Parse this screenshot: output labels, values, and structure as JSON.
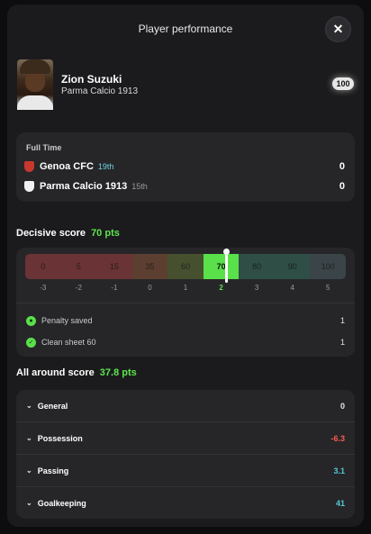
{
  "header": {
    "title": "Player performance",
    "close_label": "✕"
  },
  "player": {
    "name": "Zion Suzuki",
    "team": "Parma Calcio 1913",
    "score": "100"
  },
  "full_time": {
    "label": "Full Time",
    "teams": [
      {
        "name": "Genoa CFC",
        "rank": "19th",
        "score": "0",
        "rank_color": "#6fd3e0",
        "crest_color": "#c9382e"
      },
      {
        "name": "Parma Calcio 1913",
        "rank": "15th",
        "score": "0",
        "rank_color": "#9a9a9e",
        "crest_color": "#f0f0f0"
      }
    ]
  },
  "decisive": {
    "label": "Decisive score",
    "points": "70 pts",
    "scale_values": [
      "0",
      "5",
      "15",
      "35",
      "60",
      "70",
      "80",
      "90",
      "100"
    ],
    "scale_ticks": [
      "-3",
      "-2",
      "-1",
      "0",
      "1",
      "2",
      "3",
      "4",
      "5"
    ],
    "active_index": 5,
    "stats": [
      {
        "label": "Penalty saved",
        "value": "1",
        "icon": "penalty-saved-icon"
      },
      {
        "label": "Clean sheet 60",
        "value": "1",
        "icon": "clean-sheet-icon"
      }
    ]
  },
  "all_around": {
    "label": "All around score",
    "points": "37.8 pts",
    "categories": [
      {
        "label": "General",
        "value": "0",
        "color": "#e6e6e8"
      },
      {
        "label": "Possession",
        "value": "-6.3",
        "color": "#ff5a4e"
      },
      {
        "label": "Passing",
        "value": "3.1",
        "color": "#52c9d6"
      },
      {
        "label": "Goalkeeping",
        "value": "41",
        "color": "#52c9d6"
      }
    ]
  },
  "colors": {
    "accent_green": "#5ee44f",
    "segment_colors": [
      "#6a3335",
      "#6a3335",
      "#6a3335",
      "#5c3f30",
      "#46502f",
      "#59e04a",
      "#2e4e46",
      "#2e4e46",
      "#3b4448"
    ]
  }
}
